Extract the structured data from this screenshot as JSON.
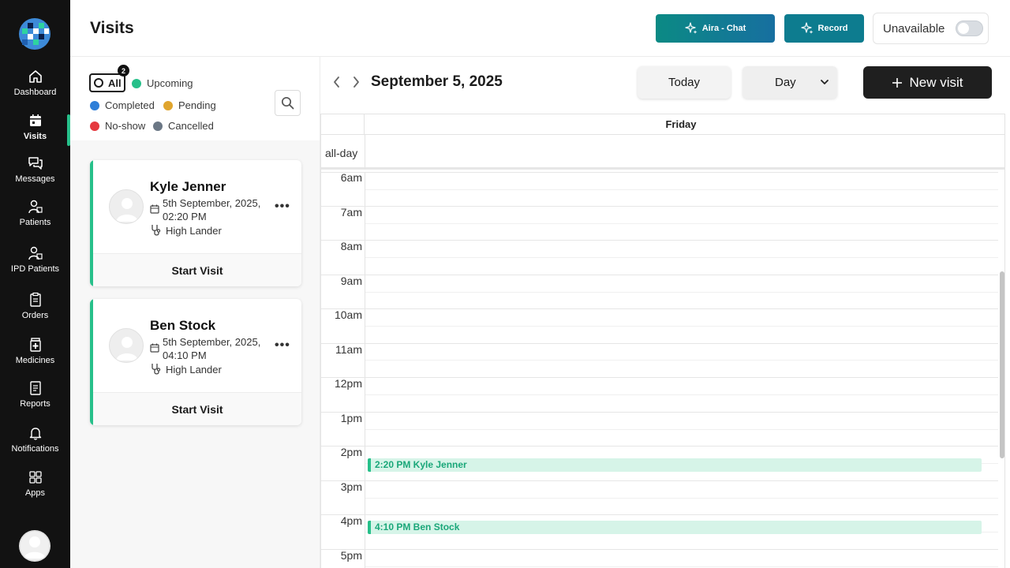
{
  "sidebar": {
    "items": [
      {
        "label": "Dashboard",
        "icon": "home-icon"
      },
      {
        "label": "Visits",
        "icon": "calendar-icon"
      },
      {
        "label": "Messages",
        "icon": "chat-icon"
      },
      {
        "label": "Patients",
        "icon": "patient-icon"
      },
      {
        "label": "IPD Patients",
        "icon": "ipd-patient-icon"
      },
      {
        "label": "Orders",
        "icon": "clipboard-icon"
      },
      {
        "label": "Medicines",
        "icon": "medicine-bottle-icon"
      },
      {
        "label": "Reports",
        "icon": "report-icon"
      },
      {
        "label": "Notifications",
        "icon": "bell-icon"
      },
      {
        "label": "Apps",
        "icon": "apps-grid-icon"
      }
    ],
    "active": "Visits"
  },
  "header": {
    "title": "Visits",
    "aira_label": "Aira - Chat",
    "record_label": "Record",
    "availability_label": "Unavailable",
    "availability_on": false
  },
  "filters": {
    "all_label": "All",
    "all_count": "2",
    "legend": [
      {
        "label": "Upcoming",
        "color": "#27c08a"
      },
      {
        "label": "Completed",
        "color": "#2f7fd8"
      },
      {
        "label": "Pending",
        "color": "#e0a52e"
      },
      {
        "label": "No-show",
        "color": "#e5393f"
      },
      {
        "label": "Cancelled",
        "color": "#6b7785"
      }
    ]
  },
  "visits": [
    {
      "name": "Kyle Jenner",
      "date": "5th September, 2025, 02:20 PM",
      "location": "High Lander",
      "action": "Start Visit"
    },
    {
      "name": "Ben Stock",
      "date": "5th September, 2025, 04:10 PM",
      "location": "High Lander",
      "action": "Start Visit"
    }
  ],
  "calendar": {
    "date_title": "September 5, 2025",
    "today_label": "Today",
    "view_label": "Day",
    "new_visit_label": "New visit",
    "day_header": "Friday",
    "all_day_label": "all-day",
    "hours": [
      "6am",
      "7am",
      "8am",
      "9am",
      "10am",
      "11am",
      "12pm",
      "1pm",
      "2pm",
      "3pm",
      "4pm",
      "5pm"
    ],
    "events": [
      {
        "label": "2:20 PM Kyle Jenner"
      },
      {
        "label": "4:10 PM Ben Stock"
      }
    ]
  },
  "colors": {
    "accent": "#27c08a",
    "sidebar_bg": "#121212",
    "primary_dark": "#1f1f1f"
  }
}
